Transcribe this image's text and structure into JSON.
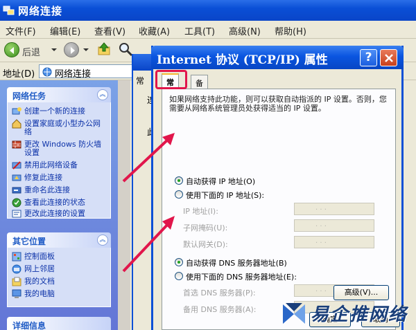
{
  "window": {
    "title": "网络连接"
  },
  "menu": [
    "文件(F)",
    "编辑(E)",
    "查看(V)",
    "收藏(A)",
    "工具(T)",
    "高级(N)",
    "帮助(H)"
  ],
  "toolbar": {
    "back": "后退",
    "search": "搜"
  },
  "address": {
    "label": "地址(D)",
    "value": "网络连接"
  },
  "sidebar": {
    "network_tasks": {
      "title": "网络任务",
      "items": [
        "创建一个新的连接",
        "设置家庭或小型办公网络",
        "更改 Windows 防火墙设置",
        "禁用此网络设备",
        "修复此连接",
        "重命名此连接",
        "查看此连接的状态",
        "更改此连接的设置"
      ]
    },
    "other_places": {
      "title": "其它位置",
      "items": [
        "控制面板",
        "网上邻居",
        "我的文档",
        "我的电脑"
      ]
    },
    "details": {
      "title": "详细信息"
    }
  },
  "bg_dialog": {
    "tab": "常",
    "lines": [
      "连",
      "此"
    ]
  },
  "dialog": {
    "title": "Internet 协议 (TCP/IP) 属性",
    "help": "?",
    "tabs": {
      "general": "常规",
      "alternate": "备用配置"
    },
    "description": "如果网络支持此功能，则可以获取自动指派的 IP 设置。否则，您需要从网络系统管理员处获得适当的 IP 设置。",
    "ip": {
      "auto_label": "自动获得 IP 地址(O)",
      "manual_label": "使用下面的 IP 地址(S):",
      "auto_selected": true,
      "fields": [
        {
          "label": "IP 地址(I):",
          "value": ". . ."
        },
        {
          "label": "子网掩码(U):",
          "value": ". . ."
        },
        {
          "label": "默认网关(D):",
          "value": ". . ."
        }
      ]
    },
    "dns": {
      "auto_label": "自动获得 DNS 服务器地址(B)",
      "manual_label": "使用下面的 DNS 服务器地址(E):",
      "auto_selected": true,
      "fields": [
        {
          "label": "首选 DNS 服务器(P):",
          "value": ". . ."
        },
        {
          "label": "备用 DNS 服务器(A):",
          "value": ". . ."
        }
      ]
    },
    "advanced_button": "高级(V)...",
    "ok_button": "确定",
    "cancel_button": "取消"
  },
  "colors": {
    "titlebar": "#0a4fd6",
    "highlight": "#e1164b",
    "sidebar": "#6f8ee0"
  },
  "watermark": "易企推网络"
}
